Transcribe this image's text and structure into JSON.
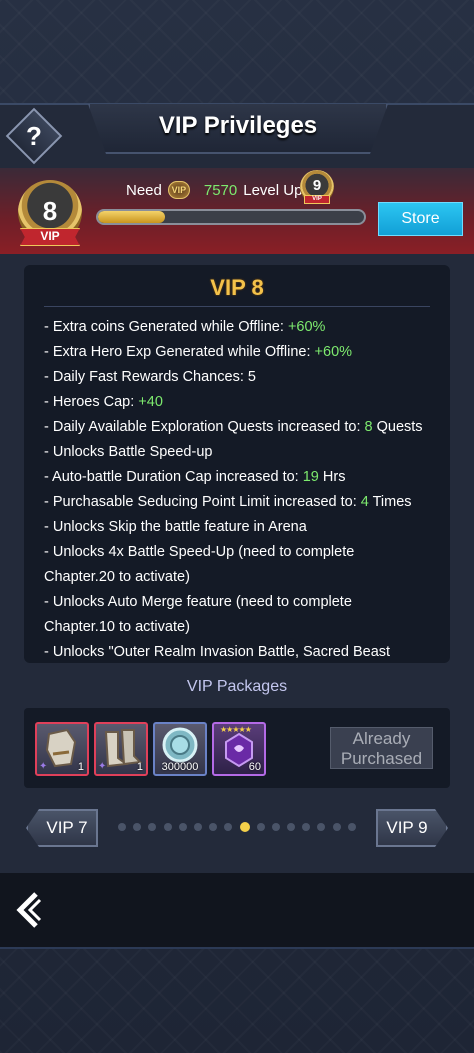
{
  "header": {
    "title": "VIP Privileges",
    "help_label": "?"
  },
  "vip_status": {
    "current_level": "8",
    "badge_label": "VIP",
    "need_prefix": "Need",
    "need_icon_label": "VIP",
    "need_amount": "7570",
    "need_suffix": "Level Up",
    "next_level": "9",
    "next_badge_label": "VIP",
    "progress_fraction": 0.25,
    "store_label": "Store"
  },
  "privileges": {
    "heading": "VIP 8",
    "lines": [
      {
        "text": "- Extra coins Generated while Offline: ",
        "value": "+60%"
      },
      {
        "text": "- Extra Hero Exp Generated while Offline: ",
        "value": "+60%"
      },
      {
        "text": "- Daily Fast Rewards Chances: 5",
        "value": ""
      },
      {
        "text": "- Heroes Cap: ",
        "value": "+40"
      },
      {
        "text": "- Daily Available Exploration Quests increased to: ",
        "value": "8",
        "suffix": " Quests"
      },
      {
        "text": "- Unlocks Battle Speed-up",
        "value": ""
      },
      {
        "text": "- Auto-battle Duration Cap increased to: ",
        "value": "19",
        "suffix": " Hrs"
      },
      {
        "text": "- Purchasable Seducing Point Limit increased to: ",
        "value": "4",
        "suffix": " Times"
      },
      {
        "text": "- Unlocks Skip the battle feature in Arena",
        "value": ""
      },
      {
        "text": "- Unlocks 4x Battle Speed-Up (need to complete",
        "value": ""
      },
      {
        "text": "Chapter.20 to activate)",
        "value": ""
      },
      {
        "text": "- Unlocks Auto Merge feature (need to complete",
        "value": ""
      },
      {
        "text": "Chapter.10 to activate)",
        "value": ""
      },
      {
        "text": "- Unlocks \"Outer Realm Invasion Battle, Sacred Beast",
        "value": ""
      }
    ]
  },
  "packages": {
    "label": "VIP Packages",
    "items": [
      {
        "name": "gauntlet-icon",
        "qty": "1"
      },
      {
        "name": "boots-icon",
        "qty": "1"
      },
      {
        "name": "coin-icon",
        "qty": "300000"
      },
      {
        "name": "purple-crystal-icon",
        "qty": "60",
        "stars": "★★★★★"
      }
    ],
    "purchased_line1": "Already",
    "purchased_line2": "Purchased"
  },
  "pager": {
    "prev_label": "VIP 7",
    "next_label": "VIP 9",
    "dot_count": 16,
    "active_index": 8
  },
  "colors": {
    "highlight_green": "#7dea6e",
    "heading_gold": "#f4c24a",
    "store_blue": "#1fb4e8"
  }
}
